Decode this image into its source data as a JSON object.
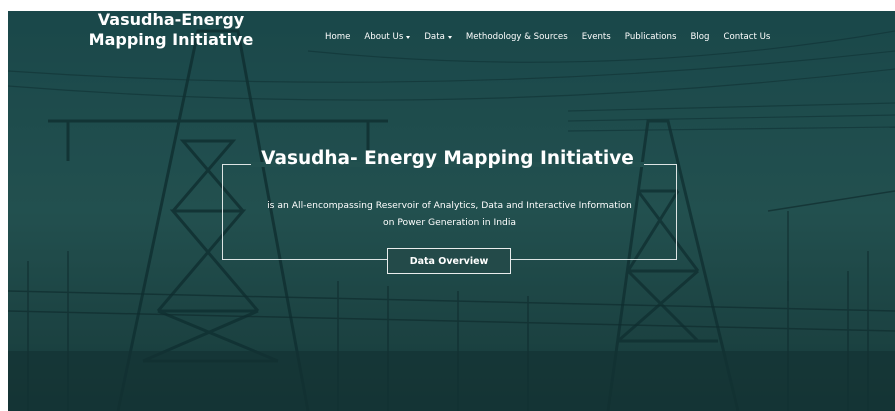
{
  "brand": {
    "line1": "Vasudha-Energy",
    "line2": "Mapping Initiative"
  },
  "nav": {
    "home": "Home",
    "about": "About Us",
    "data": "Data",
    "methodology": "Methodology & Sources",
    "events": "Events",
    "publications": "Publications",
    "blog": "Blog",
    "contact": "Contact Us"
  },
  "hero": {
    "title": "Vasudha- Energy Mapping Initiative",
    "subtitle_line1": "is an All-encompassing Reservoir of Analytics, Data and Interactive Information",
    "subtitle_line2": "on Power Generation in India",
    "cta_label": "Data Overview"
  },
  "colors": {
    "overlay": "#1d4a4c",
    "text": "#ffffff"
  }
}
